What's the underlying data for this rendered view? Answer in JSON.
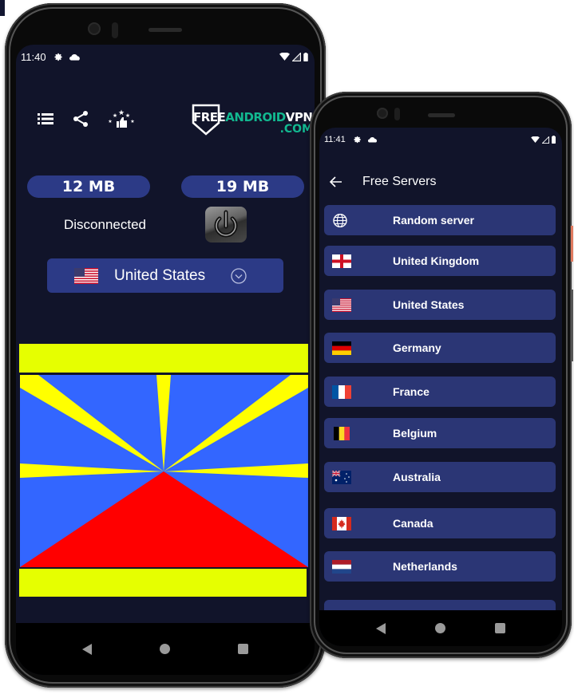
{
  "left_phone": {
    "status_bar": {
      "time": "11:40",
      "left_icons": [
        "gear-icon",
        "cloud-icon"
      ],
      "right_icons": [
        "wifi-icon",
        "signal-icon",
        "battery-icon"
      ]
    },
    "toolbar": {
      "icons": [
        "server-list-icon",
        "share-icon",
        "rate-icon"
      ]
    },
    "logo": {
      "free": "FREE",
      "android": "ANDROID",
      "vpn": "VPN",
      "com": ".COM",
      "color_primary": "#12b890"
    },
    "usage": {
      "download": "12 MB",
      "upload": "19 MB"
    },
    "connection_status": "Disconnected",
    "power_button_icon": "power-icon",
    "selected_country": {
      "name": "United States",
      "flag": "us-flag-icon"
    },
    "banner": {
      "colors": {
        "yellow_band": "#e6ff00",
        "blue": "#3366ff",
        "ray_yellow": "#ffff00",
        "red": "#ff0000"
      }
    },
    "nav": [
      "back",
      "home",
      "recents"
    ]
  },
  "right_phone": {
    "status_bar": {
      "time": "11:41",
      "left_icons": [
        "gear-icon",
        "cloud-icon"
      ],
      "right_icons": [
        "wifi-icon",
        "signal-icon",
        "battery-icon"
      ]
    },
    "header": {
      "title": "Free Servers"
    },
    "servers": [
      {
        "label": "Random server",
        "flag": "globe"
      },
      {
        "label": "United Kingdom",
        "flag": "gb-eng"
      },
      {
        "label": "United States",
        "flag": "us"
      },
      {
        "label": "Germany",
        "flag": "de"
      },
      {
        "label": "France",
        "flag": "fr"
      },
      {
        "label": "Belgium",
        "flag": "be"
      },
      {
        "label": "Australia",
        "flag": "au"
      },
      {
        "label": "Canada",
        "flag": "ca"
      },
      {
        "label": "Netherlands",
        "flag": "nl"
      },
      {
        "label": "",
        "flag": ""
      }
    ],
    "nav": [
      "back",
      "home",
      "recents"
    ]
  },
  "colors": {
    "screen_bg": "#11142a",
    "pill_bg": "#2c3a86",
    "list_item_bg": "#2b3675",
    "accent_green": "#12b890"
  }
}
